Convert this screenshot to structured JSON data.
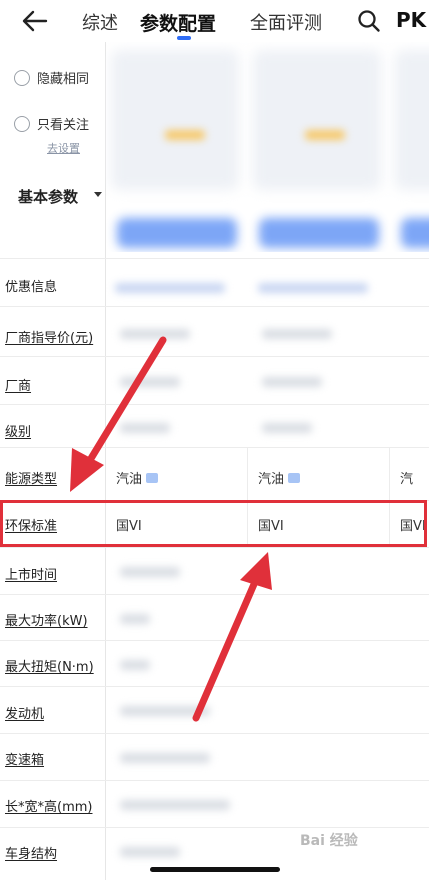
{
  "nav": {
    "tabs": [
      "综述",
      "参数配置",
      "全面评测"
    ],
    "pk_label": "PK"
  },
  "filters": {
    "hide_same": "隐藏相同",
    "only_focus": "只看关注",
    "settings_link": "去设置"
  },
  "section": {
    "title": "基本参数"
  },
  "rows": [
    "优惠信息",
    "厂商指导价(元)",
    "厂商",
    "级别",
    "能源类型",
    "环保标准",
    "上市时间",
    "最大功率(kW)",
    "最大扭矩(N·m)",
    "发动机",
    "变速箱",
    "长*宽*高(mm)",
    "车身结构"
  ],
  "cells": {
    "fuel": [
      "汽油",
      "汽油",
      "汽"
    ],
    "emission": [
      "国VI",
      "国VI",
      "国VI"
    ]
  },
  "watermark": "Bai 经验",
  "colors": {
    "accent": "#2f6df6",
    "highlight": "#e0303a"
  }
}
